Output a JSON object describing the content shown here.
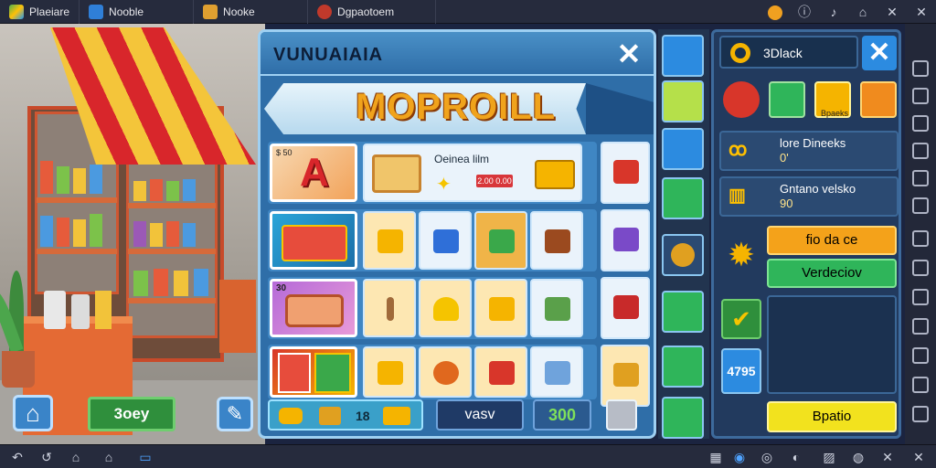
{
  "topbar": {
    "tabs": [
      {
        "label": "Plaeiare",
        "icon": "app-logo-icon"
      },
      {
        "label": "Nooble",
        "icon": "blue-app-icon"
      },
      {
        "label": "Nooke",
        "icon": "book-icon"
      },
      {
        "label": "Dgpaotoem",
        "icon": "game-icon"
      }
    ],
    "controls": [
      "coin-icon",
      "help-icon",
      "bell-icon",
      "bookmark-icon",
      "close-icon",
      "close-icon"
    ]
  },
  "scene": {
    "home_icon": "home-icon",
    "left_button_label": "3oey",
    "tool_icon": "wrench-icon"
  },
  "shop": {
    "title": "VUNUAIAIA",
    "banner": "MOPROILL",
    "featured": {
      "title": "Oeinea lilm",
      "price": "2.00 0.00"
    },
    "category_labels": [
      "$ 50",
      "30"
    ],
    "footer": {
      "count": "18",
      "button": "vasv",
      "value": "300"
    }
  },
  "panel": {
    "title": "3Dlack",
    "stats": [
      {
        "line1": "lore Dineeks",
        "line2": "0'"
      },
      {
        "line1": "Gntano velsko",
        "line2": "90"
      }
    ],
    "badge": "Bpaeks",
    "orange_button": "fio da ce",
    "green_button": "Verdeciov",
    "number_badge": "4795",
    "yellow_button": "Bpatio"
  },
  "colors": {
    "accent": "#2f6ea8",
    "orange": "#f4a21a",
    "green": "#2fb55a",
    "yellow": "#f2e21e"
  }
}
